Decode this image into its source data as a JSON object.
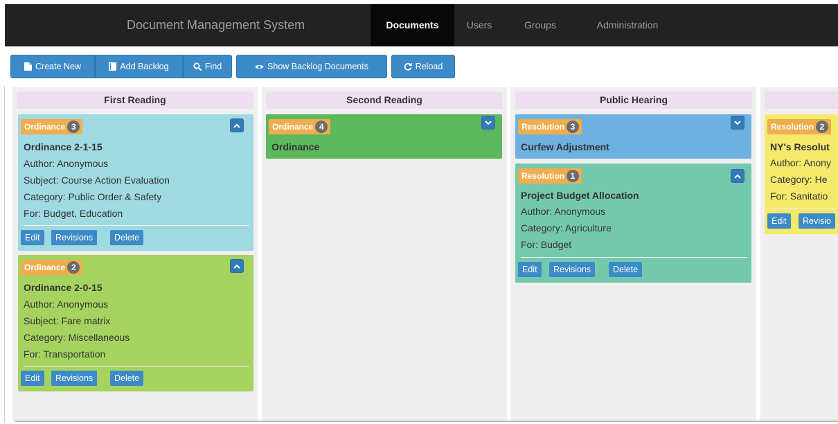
{
  "header": {
    "brand": "Document Management System",
    "nav": [
      "Documents",
      "Users",
      "Groups",
      "Administration"
    ],
    "active_nav": "Documents"
  },
  "toolbar": {
    "create_new": "Create New",
    "add_backlog": "Add Backlog",
    "find": "Find",
    "show_backlog": "Show Backlog Documents",
    "reload": "Reload"
  },
  "colors": {
    "navbar": "#222222",
    "button": "#3c8ac7",
    "column_header": "#eedff0",
    "type_label": "#f0ad4e",
    "card_teal": "#9fd9e1",
    "card_lime": "#a6d25f",
    "card_green": "#5cb85c",
    "card_blue": "#6eb0e0",
    "card_mint": "#74c9ad",
    "card_yellow": "#f5e96b"
  },
  "actions": {
    "edit": "Edit",
    "revisions": "Revisions",
    "delete": "Delete"
  },
  "columns": [
    {
      "title": "First Reading",
      "cards": [
        {
          "type": "Ordinance",
          "count": "3",
          "toggle_icon": "chevron-up-icon",
          "title": "Ordinance 2-1-15",
          "author": "Author: Anonymous",
          "subject": "Subject: Course Action Evaluation",
          "category": "Category: Public Order & Safety",
          "for": "For: Budget, Education"
        },
        {
          "type": "Ordinance",
          "count": "2",
          "toggle_icon": "chevron-up-icon",
          "title": "Ordinance 2-0-15",
          "author": "Author: Anonymous",
          "subject": "Subject: Fare matrix",
          "category": "Category: Miscellaneous",
          "for": "For: Transportation"
        }
      ]
    },
    {
      "title": "Second Reading",
      "cards": [
        {
          "type": "Ordinance",
          "count": "4",
          "toggle_icon": "chevron-down-icon",
          "title": "Ordinance"
        }
      ]
    },
    {
      "title": "Public Hearing",
      "cards": [
        {
          "type": "Resolution",
          "count": "3",
          "toggle_icon": "chevron-down-icon",
          "title": "Curfew Adjustment"
        },
        {
          "type": "Resolution",
          "count": "1",
          "toggle_icon": "chevron-up-icon",
          "title": "Project Budget Allocation",
          "author": "Author: Anonymous",
          "category": "Category: Agriculture",
          "for": "For: Budget"
        }
      ]
    },
    {
      "title": "",
      "cards": [
        {
          "type": "Resolution",
          "count": "2",
          "title": "NY's Resolut",
          "author": "Author: Anony",
          "category": "Category: He",
          "for": "For: Sanitatio",
          "edit": "Edit",
          "revisions": "Revisio"
        }
      ]
    }
  ]
}
